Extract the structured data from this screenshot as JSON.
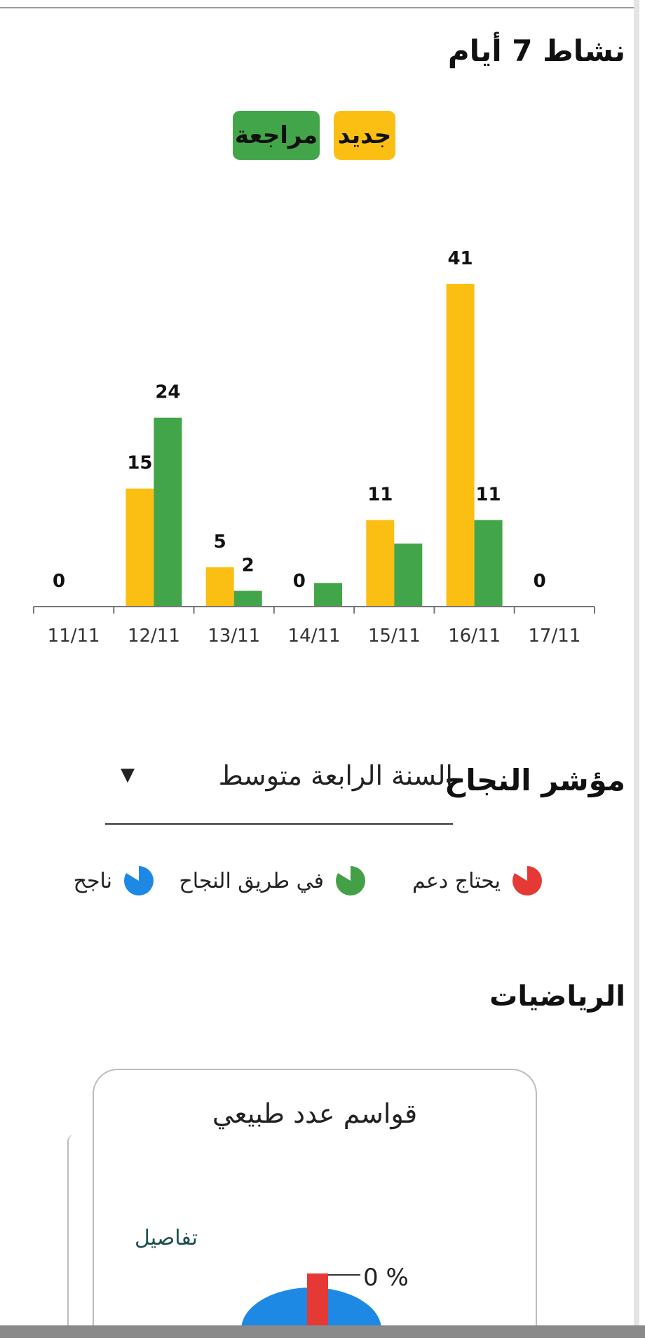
{
  "activity": {
    "title": "نشاط 7 أيام",
    "legend_new": "جديد",
    "legend_review": "مراجعة"
  },
  "chart_data": {
    "type": "bar",
    "categories": [
      "11/11",
      "12/11",
      "13/11",
      "14/11",
      "15/11",
      "16/11",
      "17/11"
    ],
    "series": [
      {
        "name": "جديد",
        "color": "#fbbf14",
        "values": [
          0,
          15,
          5,
          0,
          11,
          41,
          0
        ]
      },
      {
        "name": "مراجعة",
        "color": "#43a549",
        "values": [
          0,
          24,
          2,
          3,
          8,
          11,
          0
        ]
      }
    ],
    "data_labels": [
      {
        "category": "11/11",
        "text": "0",
        "series": "جديد"
      },
      {
        "category": "12/11",
        "text": "15",
        "series": "جديد"
      },
      {
        "category": "12/11",
        "text": "24",
        "series": "مراجعة"
      },
      {
        "category": "13/11",
        "text": "5",
        "series": "جديد"
      },
      {
        "category": "13/11",
        "text": "2",
        "series": "مراجعة"
      },
      {
        "category": "14/11",
        "text": "0",
        "series": "جديد"
      },
      {
        "category": "15/11",
        "text": "11",
        "series": "جديد"
      },
      {
        "category": "16/11",
        "text": "41",
        "series": "جديد"
      },
      {
        "category": "16/11",
        "text": "11",
        "series": "مراجعة"
      },
      {
        "category": "17/11",
        "text": "0",
        "series": "جديد"
      }
    ],
    "ylim": [
      0,
      45
    ],
    "grid": false,
    "legend": "top"
  },
  "success": {
    "title": "مؤشر النجاح",
    "dropdown_value": "السنة الرابعة متوسط",
    "legend": [
      {
        "label": "يحتاج دعم",
        "color": "#e53935"
      },
      {
        "label": "في طريق النجاح",
        "color": "#43a047"
      },
      {
        "label": "ناجح",
        "color": "#1e88e5"
      }
    ]
  },
  "subject": "الرياضيات",
  "card": {
    "title": "قواسم عدد طبيعي",
    "details_link": "تفاصيل",
    "percent": "0 %",
    "progress_fraction": 0
  }
}
